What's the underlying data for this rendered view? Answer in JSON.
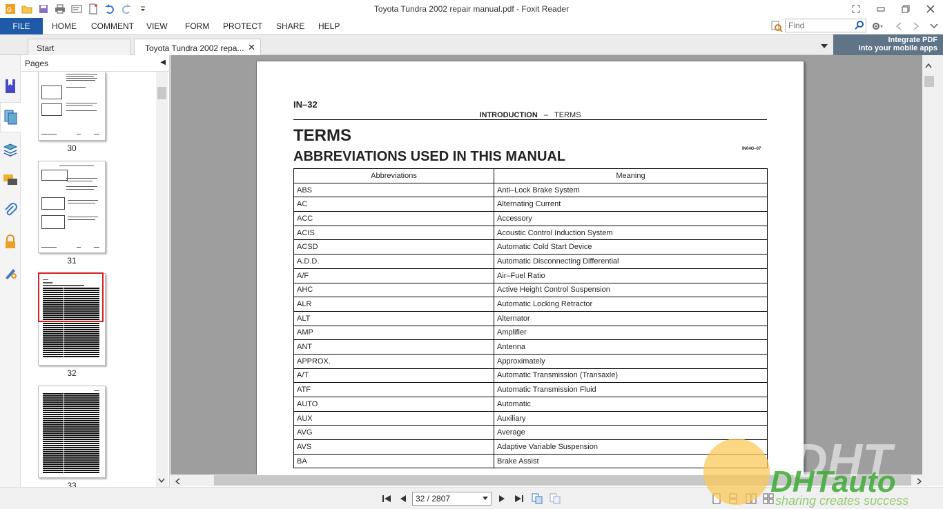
{
  "window": {
    "title": "Toyota Tundra 2002 repair manual.pdf - Foxit Reader"
  },
  "menu": {
    "file": "FILE",
    "items": [
      "HOME",
      "COMMENT",
      "VIEW",
      "FORM",
      "PROTECT",
      "SHARE",
      "HELP"
    ]
  },
  "search": {
    "placeholder": "Find"
  },
  "tabs": [
    {
      "label": "Start"
    },
    {
      "label": "Toyota Tundra 2002 repa..."
    }
  ],
  "promo": {
    "line1": "Integrate PDF",
    "line2": "into your mobile apps"
  },
  "pages_panel": {
    "title": "Pages",
    "thumbs": [
      "30",
      "31",
      "32",
      "33"
    ]
  },
  "document": {
    "page_label": "IN–32",
    "header_section": "INTRODUCTION",
    "header_dash": "–",
    "header_topic": "TERMS",
    "heading": "TERMS",
    "subheading": "ABBREVIATIONS USED IN THIS MANUAL",
    "code": "IN04G–07",
    "table": {
      "headers": [
        "Abbreviations",
        "Meaning"
      ],
      "rows": [
        [
          "ABS",
          "Anti–Lock Brake System"
        ],
        [
          "AC",
          "Alternating Current"
        ],
        [
          "ACC",
          "Accessory"
        ],
        [
          "ACIS",
          "Acoustic Control Induction System"
        ],
        [
          "ACSD",
          "Automatic Cold Start Device"
        ],
        [
          "A.D.D.",
          "Automatic Disconnecting Differential"
        ],
        [
          "A/F",
          "Air–Fuel Ratio"
        ],
        [
          "AHC",
          "Active Height Control Suspension"
        ],
        [
          "ALR",
          "Automatic Locking Retractor"
        ],
        [
          "ALT",
          "Alternator"
        ],
        [
          "AMP",
          "Amplifier"
        ],
        [
          "ANT",
          "Antenna"
        ],
        [
          "APPROX.",
          "Approximately"
        ],
        [
          "A/T",
          "Automatic Transmission (Transaxle)"
        ],
        [
          "ATF",
          "Automatic Transmission Fluid"
        ],
        [
          "AUTO",
          "Automatic"
        ],
        [
          "AUX",
          "Auxiliary"
        ],
        [
          "AVG",
          "Average"
        ],
        [
          "AVS",
          "Adaptive Variable Suspension"
        ],
        [
          "BA",
          "Brake Assist"
        ]
      ]
    }
  },
  "status": {
    "page_indicator": "32 / 2807"
  },
  "watermark": {
    "brand": "DHTauto",
    "tagline": "sharing creates success"
  },
  "colors": {
    "file_button": "#1e5aa8",
    "selection": "#d42020",
    "doc_background": "#9e9e9e"
  }
}
